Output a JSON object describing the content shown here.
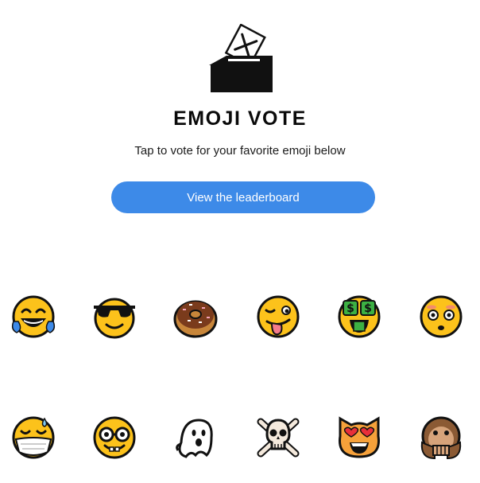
{
  "header": {
    "logo_icon": "ballot-box-icon",
    "title": "EMOJI VOTE",
    "subtitle": "Tap to vote for your favorite emoji below"
  },
  "leaderboard_button": {
    "label": "View the leaderboard",
    "color": "#3d8ae8"
  },
  "emojis": [
    {
      "name": "face-with-tears-of-joy"
    },
    {
      "name": "smiling-face-with-sunglasses"
    },
    {
      "name": "doughnut"
    },
    {
      "name": "winking-face-with-tongue"
    },
    {
      "name": "money-mouth-face"
    },
    {
      "name": "flushed-face"
    },
    {
      "name": "face-with-medical-mask"
    },
    {
      "name": "nerd-face"
    },
    {
      "name": "ghost"
    },
    {
      "name": "skull-and-crossbones"
    },
    {
      "name": "heart-eyes-cat"
    },
    {
      "name": "speak-no-evil-monkey"
    }
  ]
}
